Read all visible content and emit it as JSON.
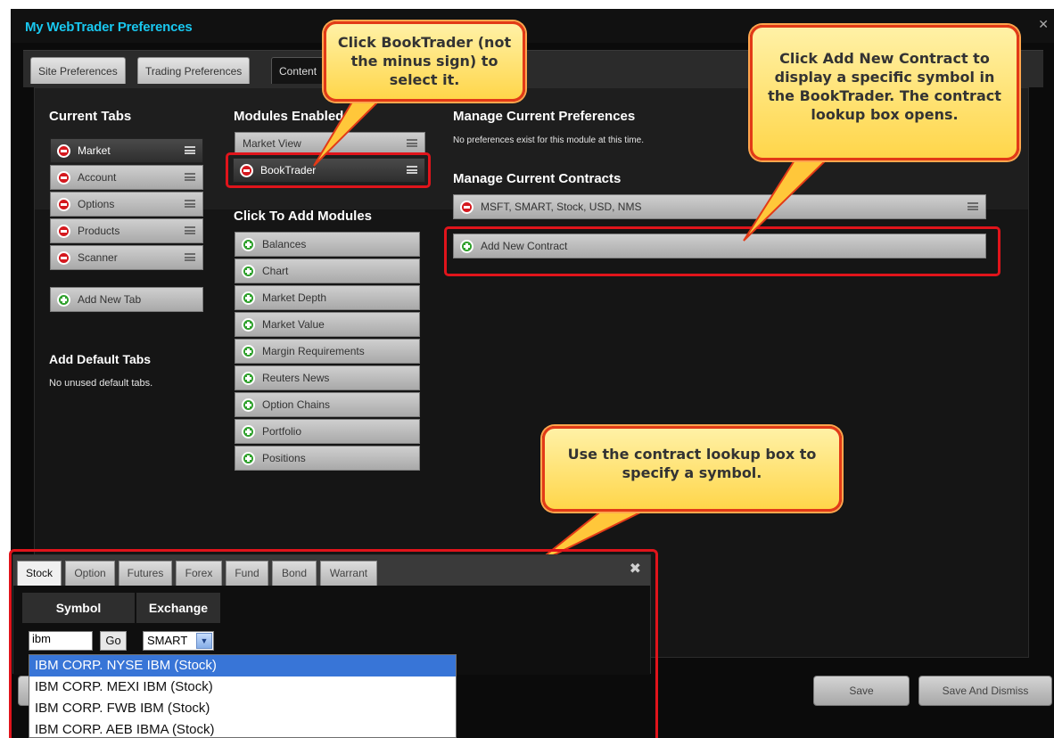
{
  "window": {
    "title": "My WebTrader Preferences"
  },
  "tabs": [
    "Site Preferences",
    "Trading Preferences",
    "Content"
  ],
  "current_tabs": {
    "heading": "Current Tabs",
    "items": [
      "Market",
      "Account",
      "Options",
      "Products",
      "Scanner"
    ],
    "add_label": "Add New Tab"
  },
  "default_tabs": {
    "heading": "Add Default Tabs",
    "note": "No unused default tabs."
  },
  "modules_enabled": {
    "heading": "Modules Enabled",
    "items": [
      "Market View",
      "BookTrader"
    ]
  },
  "add_modules": {
    "heading": "Click To Add Modules",
    "items": [
      "Balances",
      "Chart",
      "Market Depth",
      "Market Value",
      "Margin Requirements",
      "Reuters News",
      "Option Chains",
      "Portfolio",
      "Positions"
    ]
  },
  "preferences": {
    "heading": "Manage Current Preferences",
    "note": "No preferences exist for this module at this time."
  },
  "contracts": {
    "heading": "Manage Current Contracts",
    "items": [
      "MSFT, SMART, Stock, USD, NMS"
    ],
    "add_label": "Add New Contract"
  },
  "buttons": {
    "save": "Save",
    "save_dismiss": "Save And Dismiss"
  },
  "callouts": {
    "booktrader": "Click BookTrader (not the minus sign) to select it.",
    "add_contract": "Click Add New Contract to display a specific symbol in the BookTrader. The contract lookup box opens.",
    "lookup": "Use the contract lookup box to specify a symbol."
  },
  "lookup": {
    "tabs": [
      "Stock",
      "Option",
      "Futures",
      "Forex",
      "Fund",
      "Bond",
      "Warrant"
    ],
    "symbol_header": "Symbol",
    "exchange_header": "Exchange",
    "symbol_value": "ibm",
    "go_label": "Go",
    "exchange_value": "SMART",
    "close_glyph": "✖",
    "results": [
      "IBM CORP. NYSE IBM (Stock)",
      "IBM CORP. MEXI IBM (Stock)",
      "IBM CORP. FWB IBM (Stock)",
      "IBM CORP. AEB IBMA (Stock)"
    ]
  },
  "colors": {
    "accent": "#19c7ef",
    "highlight_box": "#e0141b",
    "callout_fill": "#ffd64a",
    "selection": "#3875d7"
  }
}
